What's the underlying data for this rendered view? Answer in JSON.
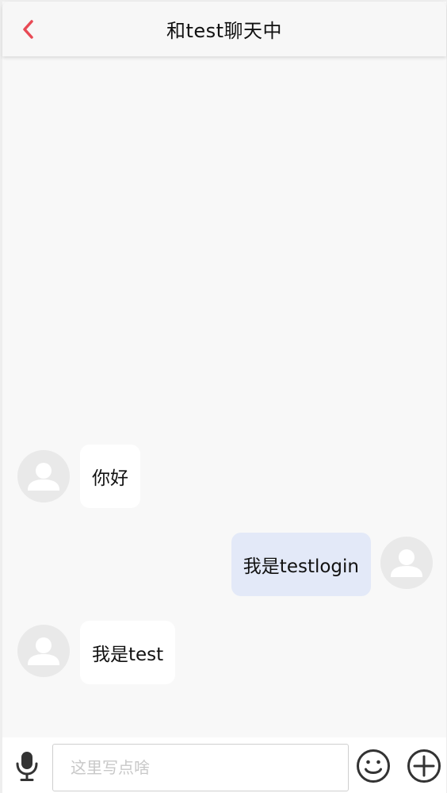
{
  "header": {
    "title": "和test聊天中",
    "back_icon": "chevron-left-icon",
    "accent_color": "#e84a55"
  },
  "messages": [
    {
      "side": "in",
      "text": "你好"
    },
    {
      "side": "out",
      "text": "我是testlogin"
    },
    {
      "side": "in",
      "text": "我是test"
    }
  ],
  "composer": {
    "placeholder": "这里写点啥",
    "value": "",
    "mic_icon": "microphone-icon",
    "emoji_icon": "smiley-icon",
    "plus_icon": "plus-circle-icon"
  },
  "colors": {
    "background": "#f8f8f8",
    "incoming_bubble": "#ffffff",
    "outgoing_bubble": "#e3e9f8",
    "avatar_placeholder": "#e9e9e9"
  }
}
